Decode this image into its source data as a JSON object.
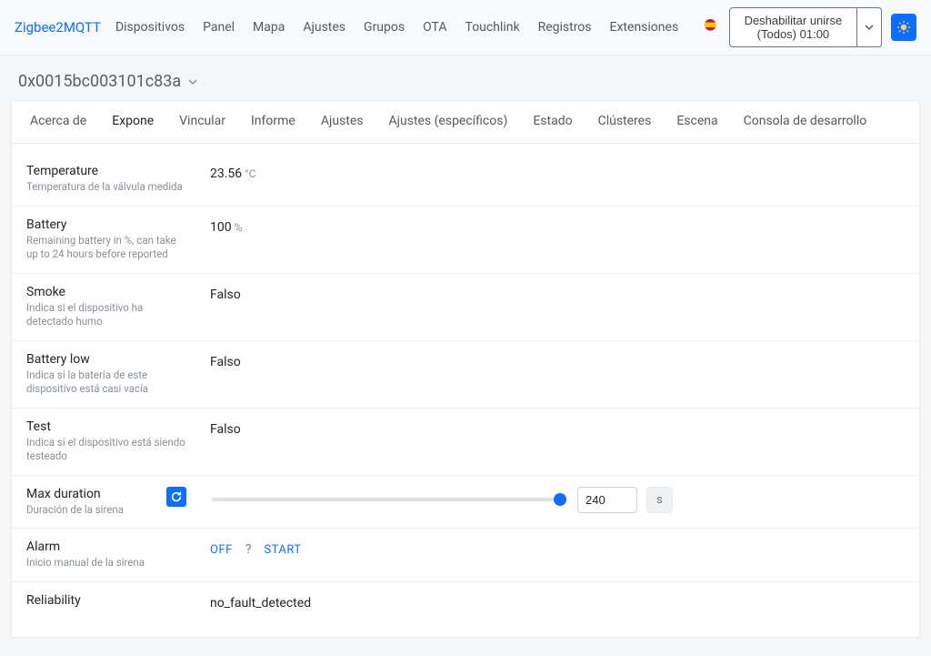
{
  "nav": {
    "brand": "Zigbee2MQTT",
    "items": [
      "Dispositivos",
      "Panel",
      "Mapa",
      "Ajustes",
      "Grupos",
      "OTA",
      "Touchlink",
      "Registros",
      "Extensiones"
    ],
    "permit_label": "Deshabilitar unirse (Todos) 01:00"
  },
  "device": {
    "title": "0x0015bc003101c83a"
  },
  "tabs": [
    "Acerca de",
    "Expone",
    "Vincular",
    "Informe",
    "Ajustes",
    "Ajustes (específicos)",
    "Estado",
    "Clústeres",
    "Escena",
    "Consola de desarrollo"
  ],
  "active_tab": 1,
  "rows": {
    "temperature": {
      "title": "Temperature",
      "desc": "Temperatura de la válvula medida",
      "value": "23.56",
      "unit": "°C"
    },
    "battery": {
      "title": "Battery",
      "desc": "Remaining battery in %, can take up to 24 hours before reported",
      "value": "100",
      "unit": "%"
    },
    "smoke": {
      "title": "Smoke",
      "desc": "Indica si el dispositivo ha detectado humo",
      "value": "Falso"
    },
    "battery_low": {
      "title": "Battery low",
      "desc": "Indica si la batería de este dispositivo está casi vacía",
      "value": "Falso"
    },
    "test": {
      "title": "Test",
      "desc": "Indica si el dispositivo está siendo testeado",
      "value": "Falso"
    },
    "max_duration": {
      "title": "Max duration",
      "desc": "Duración de la sirena",
      "value": "240",
      "unit": "s",
      "min": "0",
      "max": "600"
    },
    "alarm": {
      "title": "Alarm",
      "desc": "Inicio manual de la sirena",
      "off": "OFF",
      "start": "START",
      "q": "?"
    },
    "reliability": {
      "title": "Reliability",
      "desc": "",
      "value": "no_fault_detected"
    }
  }
}
